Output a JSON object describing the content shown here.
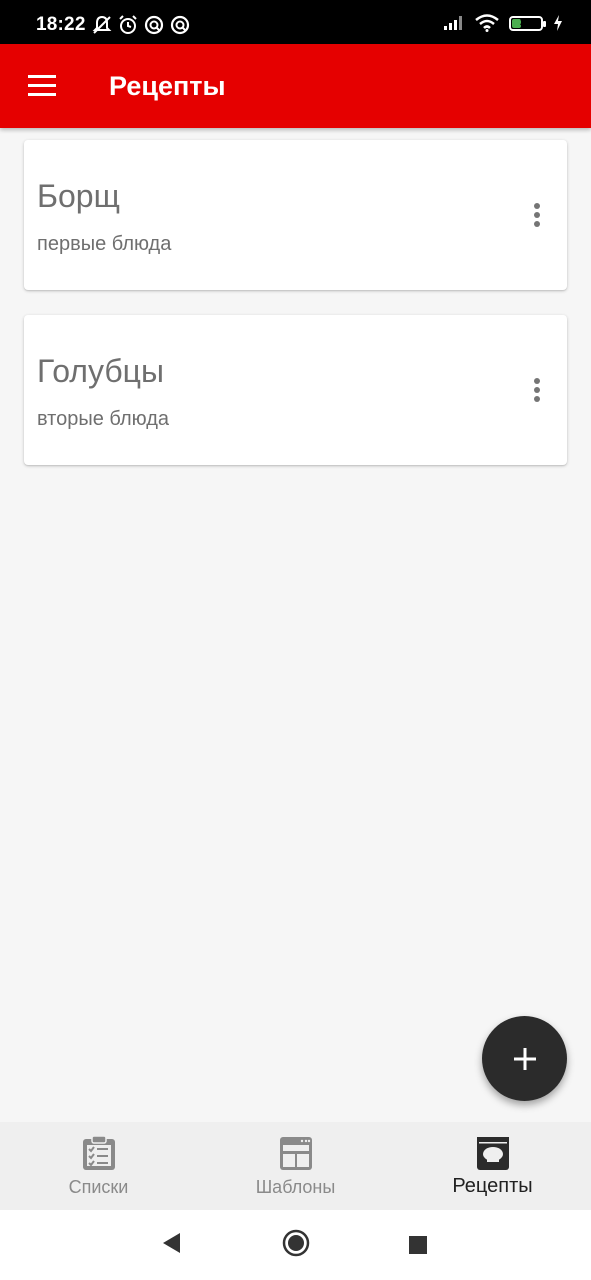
{
  "status_bar": {
    "time": "18:22",
    "battery_level": "35",
    "battery_fraction": 0.35,
    "icons": [
      "notifications-off-icon",
      "alarm-icon",
      "app-notification-icon",
      "app-notification-icon",
      "signal-icon",
      "wifi-icon",
      "battery-icon",
      "charging-icon"
    ]
  },
  "app_bar": {
    "title": "Рецепты",
    "color": "#e50000"
  },
  "recipes": [
    {
      "title": "Борщ",
      "category": "первые блюда"
    },
    {
      "title": "Голубцы",
      "category": "вторые блюда"
    }
  ],
  "fab": {
    "icon": "plus-icon"
  },
  "bottom_nav": {
    "items": [
      {
        "label": "Списки",
        "icon": "checklist-icon",
        "active": false
      },
      {
        "label": "Шаблоны",
        "icon": "template-icon",
        "active": false
      },
      {
        "label": "Рецепты",
        "icon": "recipe-book-icon",
        "active": true
      }
    ]
  },
  "system_nav": {
    "icons": [
      "back-icon",
      "home-icon",
      "recents-icon"
    ]
  }
}
